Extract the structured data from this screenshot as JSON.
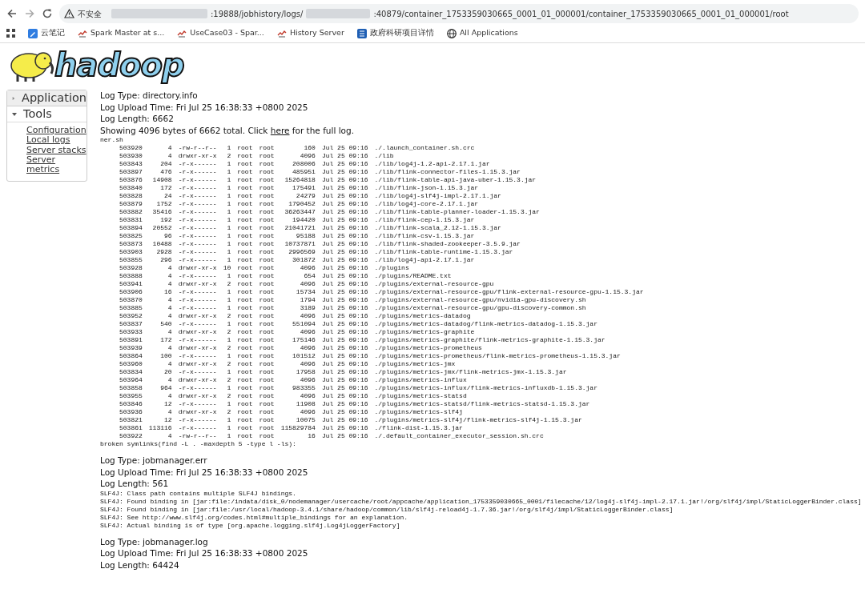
{
  "browser": {
    "security_label": "不安全",
    "address": [
      {
        "kind": "redacted"
      },
      {
        "kind": "text",
        "text": ":19888/jobhistory/logs/"
      },
      {
        "kind": "redacted"
      },
      {
        "kind": "text",
        "text": ":40879/container_1753359030665_0001_01_000001/container_1753359030665_0001_01_000001/root"
      }
    ],
    "bookmarks": [
      {
        "kind": "note",
        "label": "云笔记"
      },
      {
        "kind": "spark",
        "label": "Spark Master at s..."
      },
      {
        "kind": "spark",
        "label": "UseCase03 - Spar..."
      },
      {
        "kind": "spark",
        "label": "History Server"
      },
      {
        "kind": "gov",
        "label": "政府科研项目详情"
      },
      {
        "kind": "globe",
        "label": "All Applications"
      }
    ]
  },
  "logo": {
    "text": "hadoop"
  },
  "sidebar": [
    {
      "label": "Application",
      "expanded": false
    },
    {
      "label": "Tools",
      "expanded": true,
      "links": [
        "Configuration",
        "Local logs",
        "Server stacks",
        "Server metrics"
      ]
    }
  ],
  "logs": [
    {
      "type": "Log Type: directory.info",
      "upload": "Log Upload Time: Fri Jul 25 16:38:33 +0800 2025",
      "length": "Log Length: 6662",
      "showing": {
        "before": "Showing 4096 bytes of 6662 total. Click ",
        "link": "here",
        "after": " for the full log."
      },
      "pre_before": [
        "ner.sh"
      ],
      "rows": [
        [
          "503920",
          "4",
          "-rw-r--r--",
          "1",
          "root",
          "root",
          "160",
          "Jul 25 09:16",
          "./.launch_container.sh.crc"
        ],
        [
          "503930",
          "4",
          "drwxr-xr-x",
          "2",
          "root",
          "root",
          "4096",
          "Jul 25 09:16",
          "./lib"
        ],
        [
          "503843",
          "204",
          "-r-x------",
          "1",
          "root",
          "root",
          "208006",
          "Jul 25 09:16",
          "./lib/log4j-1.2-api-2.17.1.jar"
        ],
        [
          "503897",
          "476",
          "-r-x------",
          "1",
          "root",
          "root",
          "485951",
          "Jul 25 09:16",
          "./lib/flink-connector-files-1.15.3.jar"
        ],
        [
          "503876",
          "14908",
          "-r-x------",
          "1",
          "root",
          "root",
          "15264818",
          "Jul 25 09:16",
          "./lib/flink-table-api-java-uber-1.15.3.jar"
        ],
        [
          "503840",
          "172",
          "-r-x------",
          "1",
          "root",
          "root",
          "175491",
          "Jul 25 09:16",
          "./lib/flink-json-1.15.3.jar"
        ],
        [
          "503828",
          "24",
          "-r-x------",
          "1",
          "root",
          "root",
          "24279",
          "Jul 25 09:16",
          "./lib/log4j-slf4j-impl-2.17.1.jar"
        ],
        [
          "503879",
          "1752",
          "-r-x------",
          "1",
          "root",
          "root",
          "1790452",
          "Jul 25 09:16",
          "./lib/log4j-core-2.17.1.jar"
        ],
        [
          "503882",
          "35416",
          "-r-x------",
          "1",
          "root",
          "root",
          "36263447",
          "Jul 25 09:16",
          "./lib/flink-table-planner-loader-1.15.3.jar"
        ],
        [
          "503831",
          "192",
          "-r-x------",
          "1",
          "root",
          "root",
          "194420",
          "Jul 25 09:16",
          "./lib/flink-cep-1.15.3.jar"
        ],
        [
          "503894",
          "20552",
          "-r-x------",
          "1",
          "root",
          "root",
          "21041721",
          "Jul 25 09:16",
          "./lib/flink-scala_2.12-1.15.3.jar"
        ],
        [
          "503825",
          "96",
          "-r-x------",
          "1",
          "root",
          "root",
          "95188",
          "Jul 25 09:16",
          "./lib/flink-csv-1.15.3.jar"
        ],
        [
          "503873",
          "10488",
          "-r-x------",
          "1",
          "root",
          "root",
          "10737871",
          "Jul 25 09:16",
          "./lib/flink-shaded-zookeeper-3.5.9.jar"
        ],
        [
          "503903",
          "2928",
          "-r-x------",
          "1",
          "root",
          "root",
          "2996569",
          "Jul 25 09:16",
          "./lib/flink-table-runtime-1.15.3.jar"
        ],
        [
          "503855",
          "296",
          "-r-x------",
          "1",
          "root",
          "root",
          "301872",
          "Jul 25 09:16",
          "./lib/log4j-api-2.17.1.jar"
        ],
        [
          "503928",
          "4",
          "drwxr-xr-x",
          "10",
          "root",
          "root",
          "4096",
          "Jul 25 09:16",
          "./plugins"
        ],
        [
          "503888",
          "4",
          "-r-x------",
          "1",
          "root",
          "root",
          "654",
          "Jul 25 09:16",
          "./plugins/README.txt"
        ],
        [
          "503941",
          "4",
          "drwxr-xr-x",
          "2",
          "root",
          "root",
          "4096",
          "Jul 25 09:16",
          "./plugins/external-resource-gpu"
        ],
        [
          "503906",
          "16",
          "-r-x------",
          "1",
          "root",
          "root",
          "15734",
          "Jul 25 09:16",
          "./plugins/external-resource-gpu/flink-external-resource-gpu-1.15.3.jar"
        ],
        [
          "503870",
          "4",
          "-r-x------",
          "1",
          "root",
          "root",
          "1794",
          "Jul 25 09:16",
          "./plugins/external-resource-gpu/nvidia-gpu-discovery.sh"
        ],
        [
          "503885",
          "4",
          "-r-x------",
          "1",
          "root",
          "root",
          "3189",
          "Jul 25 09:16",
          "./plugins/external-resource-gpu/gpu-discovery-common.sh"
        ],
        [
          "503952",
          "4",
          "drwxr-xr-x",
          "2",
          "root",
          "root",
          "4096",
          "Jul 25 09:16",
          "./plugins/metrics-datadog"
        ],
        [
          "503837",
          "540",
          "-r-x------",
          "1",
          "root",
          "root",
          "551094",
          "Jul 25 09:16",
          "./plugins/metrics-datadog/flink-metrics-datadog-1.15.3.jar"
        ],
        [
          "503933",
          "4",
          "drwxr-xr-x",
          "2",
          "root",
          "root",
          "4096",
          "Jul 25 09:16",
          "./plugins/metrics-graphite"
        ],
        [
          "503891",
          "172",
          "-r-x------",
          "1",
          "root",
          "root",
          "175146",
          "Jul 25 09:16",
          "./plugins/metrics-graphite/flink-metrics-graphite-1.15.3.jar"
        ],
        [
          "503939",
          "4",
          "drwxr-xr-x",
          "2",
          "root",
          "root",
          "4096",
          "Jul 25 09:16",
          "./plugins/metrics-prometheus"
        ],
        [
          "503864",
          "100",
          "-r-x------",
          "1",
          "root",
          "root",
          "101512",
          "Jul 25 09:16",
          "./plugins/metrics-prometheus/flink-metrics-prometheus-1.15.3.jar"
        ],
        [
          "503960",
          "4",
          "drwxr-xr-x",
          "2",
          "root",
          "root",
          "4096",
          "Jul 25 09:16",
          "./plugins/metrics-jmx"
        ],
        [
          "503834",
          "20",
          "-r-x------",
          "1",
          "root",
          "root",
          "17958",
          "Jul 25 09:16",
          "./plugins/metrics-jmx/flink-metrics-jmx-1.15.3.jar"
        ],
        [
          "503964",
          "4",
          "drwxr-xr-x",
          "2",
          "root",
          "root",
          "4096",
          "Jul 25 09:16",
          "./plugins/metrics-influx"
        ],
        [
          "503858",
          "964",
          "-r-x------",
          "1",
          "root",
          "root",
          "983355",
          "Jul 25 09:16",
          "./plugins/metrics-influx/flink-metrics-influxdb-1.15.3.jar"
        ],
        [
          "503955",
          "4",
          "drwxr-xr-x",
          "2",
          "root",
          "root",
          "4096",
          "Jul 25 09:16",
          "./plugins/metrics-statsd"
        ],
        [
          "503846",
          "12",
          "-r-x------",
          "1",
          "root",
          "root",
          "11908",
          "Jul 25 09:16",
          "./plugins/metrics-statsd/flink-metrics-statsd-1.15.3.jar"
        ],
        [
          "503936",
          "4",
          "drwxr-xr-x",
          "2",
          "root",
          "root",
          "4096",
          "Jul 25 09:16",
          "./plugins/metrics-slf4j"
        ],
        [
          "503821",
          "12",
          "-r-x------",
          "1",
          "root",
          "root",
          "10075",
          "Jul 25 09:16",
          "./plugins/metrics-slf4j/flink-metrics-slf4j-1.15.3.jar"
        ],
        [
          "503861",
          "113116",
          "-r-x------",
          "1",
          "root",
          "root",
          "115829784",
          "Jul 25 09:16",
          "./flink-dist-1.15.3.jar"
        ],
        [
          "503922",
          "4",
          "-rw-r--r--",
          "1",
          "root",
          "root",
          "16",
          "Jul 25 09:16",
          "./.default_container_executor_session.sh.crc"
        ]
      ],
      "pre_after": [
        "broken symlinks(find -L . -maxdepth 5 -type l -ls):"
      ]
    },
    {
      "type": "Log Type: jobmanager.err",
      "upload": "Log Upload Time: Fri Jul 25 16:38:33 +0800 2025",
      "length": "Log Length: 561",
      "pre_after": [
        "SLF4J: Class path contains multiple SLF4J bindings.",
        "SLF4J: Found binding in [jar:file:/indata/disk_0/nodemanager/usercache/root/appcache/application_1753359030665_0001/filecache/12/log4j-slf4j-impl-2.17.1.jar!/org/slf4j/impl/StaticLoggerBinder.class]",
        "SLF4J: Found binding in [jar:file:/usr/local/hadoop-3.4.1/share/hadoop/common/lib/slf4j-reload4j-1.7.36.jar!/org/slf4j/impl/StaticLoggerBinder.class]",
        "SLF4J: See http://www.slf4j.org/codes.html#multiple_bindings for an explanation.",
        "SLF4J: Actual binding is of type [org.apache.logging.slf4j.Log4jLoggerFactory]"
      ]
    },
    {
      "type": "Log Type: jobmanager.log",
      "upload": "Log Upload Time: Fri Jul 25 16:38:33 +0800 2025",
      "length": "Log Length: 64424"
    }
  ]
}
